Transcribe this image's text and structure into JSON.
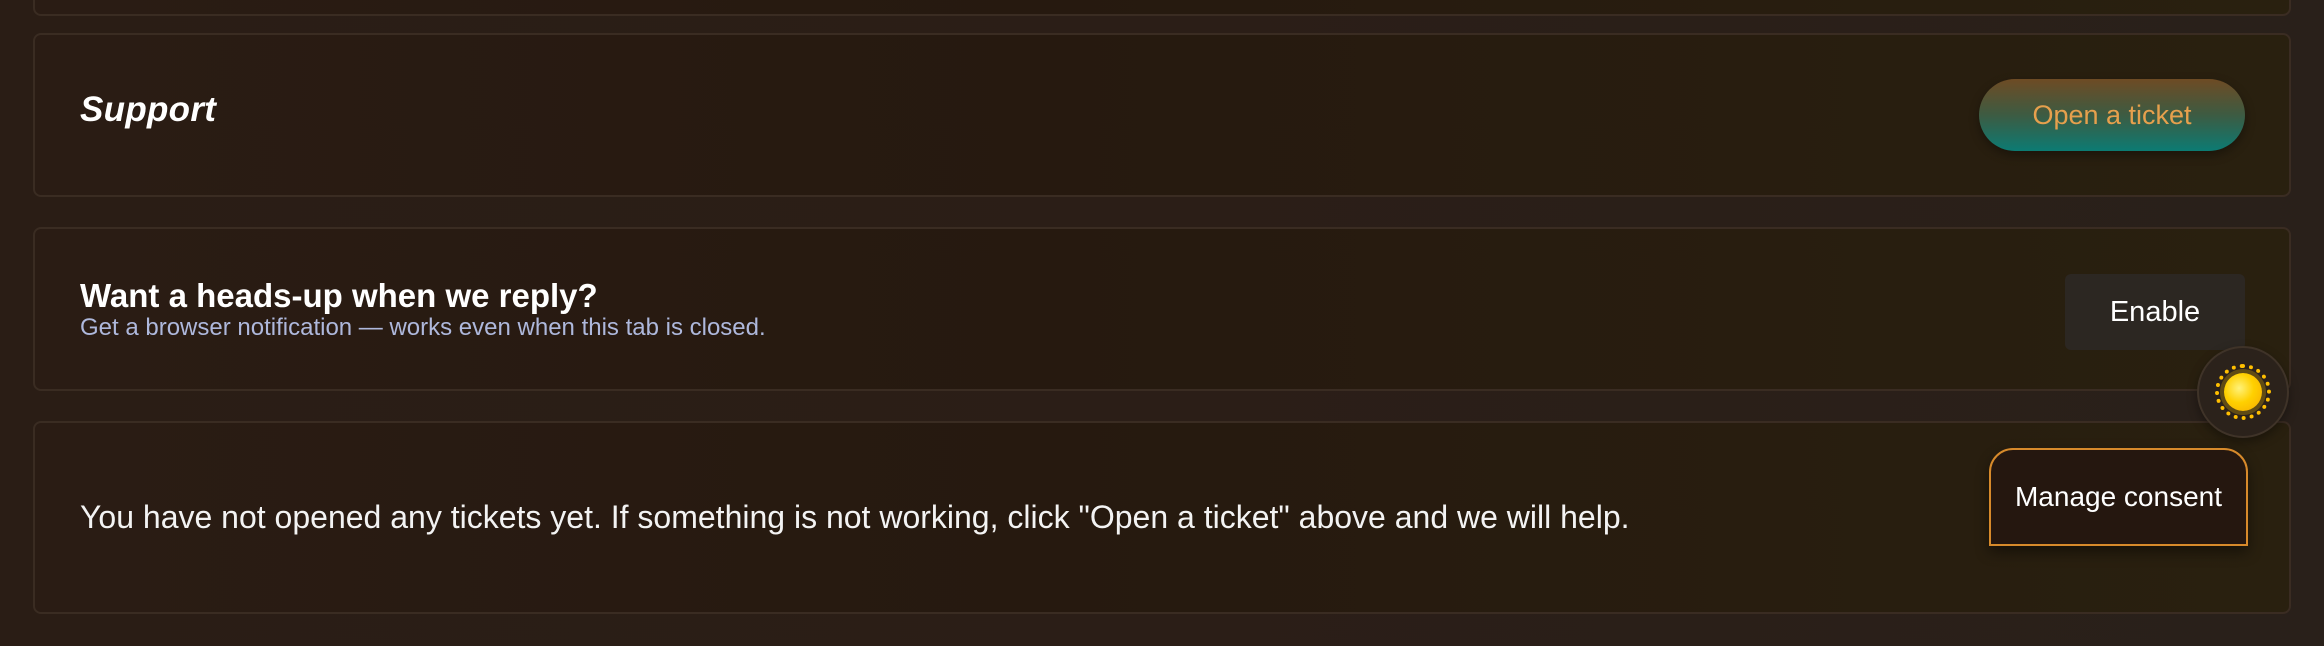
{
  "support": {
    "title": "Support",
    "open_ticket_label": "Open a ticket"
  },
  "notifications": {
    "title": "Want a heads-up when we reply?",
    "subtitle": "Get a browser notification — works even when this tab is closed.",
    "enable_label": "Enable"
  },
  "tickets": {
    "empty_message": "You have not opened any tickets yet. If something is not working, click \"Open a ticket\" above and we will help."
  },
  "theme_toggle": {
    "icon": "sun-icon"
  },
  "consent": {
    "label": "Manage consent"
  },
  "colors": {
    "background": "#2a1d15",
    "accent_orange": "#e6a04d",
    "accent_teal": "#0c7b73",
    "subtitle_blue": "#aeb8dc",
    "consent_border": "#d78a2b"
  }
}
